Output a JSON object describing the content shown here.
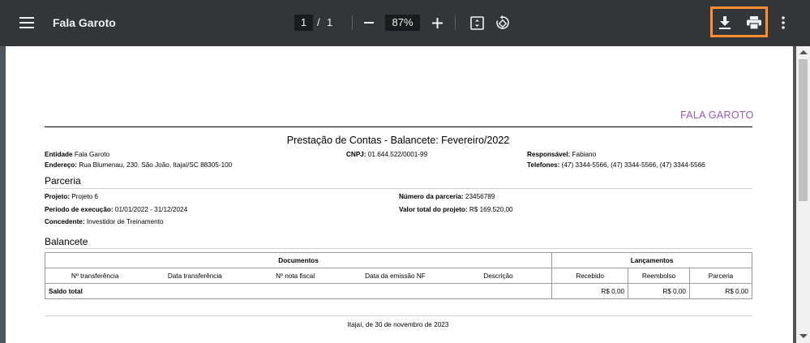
{
  "toolbar": {
    "title": "Fala Garoto",
    "page_current": "1",
    "page_sep": "/",
    "page_total": "1",
    "zoom": "87%",
    "icons": [
      "menu-icon",
      "zoom-out-icon",
      "zoom-in-icon",
      "fit-page-icon",
      "rotate-icon",
      "download-icon",
      "print-icon",
      "more-vert-icon"
    ]
  },
  "doc": {
    "brand": "FALA GAROTO",
    "title": "Prestação de Contas - Balancete: Fevereiro/2022",
    "entidade_label": "Entidade",
    "entidade": "Fala Garoto",
    "endereco_label": "Endereço:",
    "endereco": "Rua Blumenau, 230. São João, Itajaí/SC 88305-100",
    "cnpj_label": "CNPJ:",
    "cnpj": "01.644.522/0001-99",
    "responsavel_label": "Responsável:",
    "responsavel": "Fabiano",
    "telefones_label": "Telefones:",
    "telefones": "(47) 3344-5566, (47) 3344-5566, (47) 3344-5566",
    "parceria_section": "Parceria",
    "projeto_label": "Projeto:",
    "projeto": "Projeto 6",
    "periodo_label": "Período de execução:",
    "periodo": "01/01/2022 - 31/12/2024",
    "concedente_label": "Concedente:",
    "concedente": "Investidor de Treinamento",
    "numero_label": "Número da parceria:",
    "numero": "23456789",
    "valor_label": "Valor total do projeto:",
    "valor": "R$ 169.520,00",
    "balancete_section": "Balancete",
    "table": {
      "group_documentos": "Documentos",
      "group_lancamentos": "Lançamentos",
      "headers": [
        "Nº transferência",
        "Data transferência",
        "Nº nota fiscal",
        "Data da emissão NF",
        "Descrição",
        "Recebido",
        "Reembolso",
        "Parceria"
      ],
      "total_label": "Saldo total",
      "totals": [
        "R$ 0,00",
        "R$ 0,00",
        "R$ 0,00"
      ]
    },
    "footer": "Itajaí, de 30 de novembro de 2023"
  }
}
